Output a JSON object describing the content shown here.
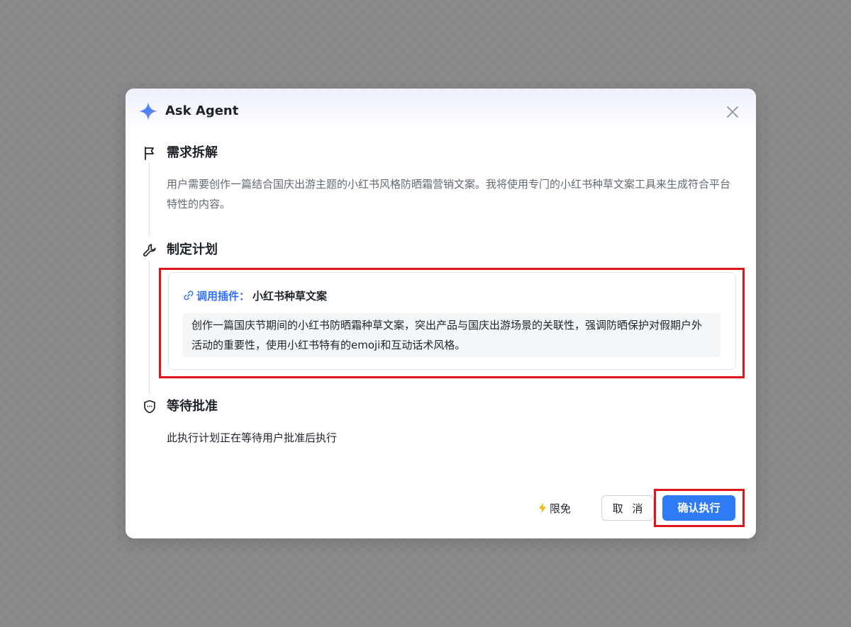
{
  "dialog": {
    "title": "Ask Agent",
    "logo_icon": "sparkle-star-icon",
    "close_icon": "close-icon"
  },
  "steps": [
    {
      "icon": "flag-icon",
      "title": "需求拆解",
      "description": "用户需要创作一篇结合国庆出游主题的小红书风格防晒霜营销文案。我将使用专门的小红书种草文案工具来生成符合平台特性的内容。"
    },
    {
      "icon": "wrench-icon",
      "title": "制定计划",
      "plugin": {
        "icon": "link-icon",
        "label": "调用插件：",
        "name": "小红书种草文案",
        "description": "创作一篇国庆节期间的小红书防晒霜种草文案，突出产品与国庆出游场景的关联性，强调防晒保护对假期户外活动的重要性，使用小红书特有的emoji和互动话术风格。"
      }
    },
    {
      "icon": "shield-icon",
      "title": "等待批准",
      "description": "此执行计划正在等待用户批准后执行"
    }
  ],
  "footer": {
    "free_icon": "lightning-icon",
    "free_label": "限免",
    "cancel_label": "取 消",
    "confirm_label": "确认执行"
  },
  "colors": {
    "accent": "#2f7bf5",
    "plugin_label": "#3370ff",
    "highlight": "#e0141c",
    "bolt": "#f7b500"
  }
}
